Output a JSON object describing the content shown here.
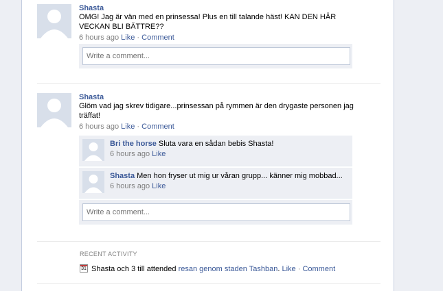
{
  "posts": [
    {
      "author": "Shasta",
      "message": "OMG! Jag är vän med en prinsessa! Plus en till talande häst! KAN DEN HÄR VECKAN BLI BÄTTRE??",
      "time": "6 hours ago",
      "like_label": "Like",
      "comment_label": "Comment",
      "write_placeholder": "Write a comment..."
    },
    {
      "author": "Shasta",
      "message": "Glöm vad jag skrev tidigare...prinsessan på rymmen är den drygaste personen jag träffat!",
      "time": "6 hours ago",
      "like_label": "Like",
      "comment_label": "Comment",
      "comments": [
        {
          "author": "Bri the horse",
          "text": "Sluta vara en sådan bebis Shasta!",
          "time": "6 hours ago",
          "like_label": "Like"
        },
        {
          "author": "Shasta",
          "text": "Men hon fryser ut mig ur våran grupp... känner mig mobbad...",
          "time": "6 hours ago",
          "like_label": "Like"
        }
      ],
      "write_placeholder": "Write a comment..."
    }
  ],
  "recent_activity": {
    "title": "Recent Activity",
    "calendar_day": "31",
    "prefix": "Shasta och 3 till attended",
    "event_link": "resan genom staden Tashban",
    "like_label": "Like",
    "comment_label": "Comment"
  },
  "colors": {
    "link": "#3b5998",
    "muted": "#808080",
    "comment_bg": "#edeff4"
  }
}
